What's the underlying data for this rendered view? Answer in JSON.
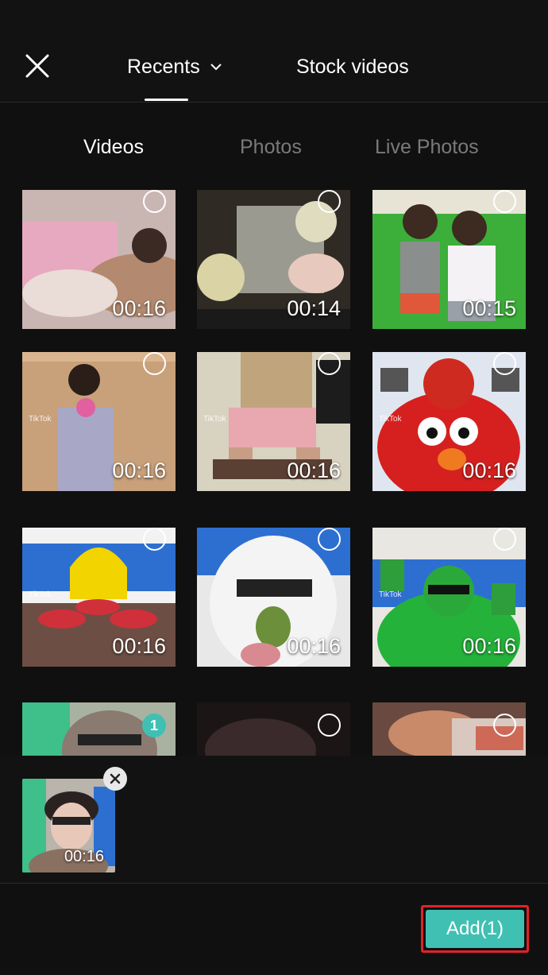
{
  "header": {
    "close_icon": "close-icon",
    "tabs": [
      {
        "label": "Recents",
        "active": true,
        "icon": "chevron-down-icon"
      },
      {
        "label": "Stock videos",
        "active": false
      }
    ]
  },
  "media_tabs": [
    {
      "label": "Videos",
      "active": true
    },
    {
      "label": "Photos",
      "active": false
    },
    {
      "label": "Live Photos",
      "active": false
    }
  ],
  "grid": {
    "items": [
      {
        "duration": "00:16",
        "selected": false
      },
      {
        "duration": "00:14",
        "selected": false
      },
      {
        "duration": "00:15",
        "selected": false
      },
      {
        "duration": "00:16",
        "selected": false
      },
      {
        "duration": "00:16",
        "selected": false
      },
      {
        "duration": "00:16",
        "selected": false
      },
      {
        "duration": "00:16",
        "selected": false
      },
      {
        "duration": "00:16",
        "selected": false
      },
      {
        "duration": "00:16",
        "selected": false
      },
      {
        "duration": "",
        "selected": true,
        "selection_index": "1"
      },
      {
        "duration": "",
        "selected": false
      },
      {
        "duration": "",
        "selected": false
      }
    ]
  },
  "tray": {
    "selected": [
      {
        "duration": "00:16",
        "remove_icon": "close-icon"
      }
    ]
  },
  "footer": {
    "add_label": "Add(1)"
  },
  "colors": {
    "accent": "#40c0b3",
    "highlight_border": "#e0232a",
    "background": "#101010"
  }
}
